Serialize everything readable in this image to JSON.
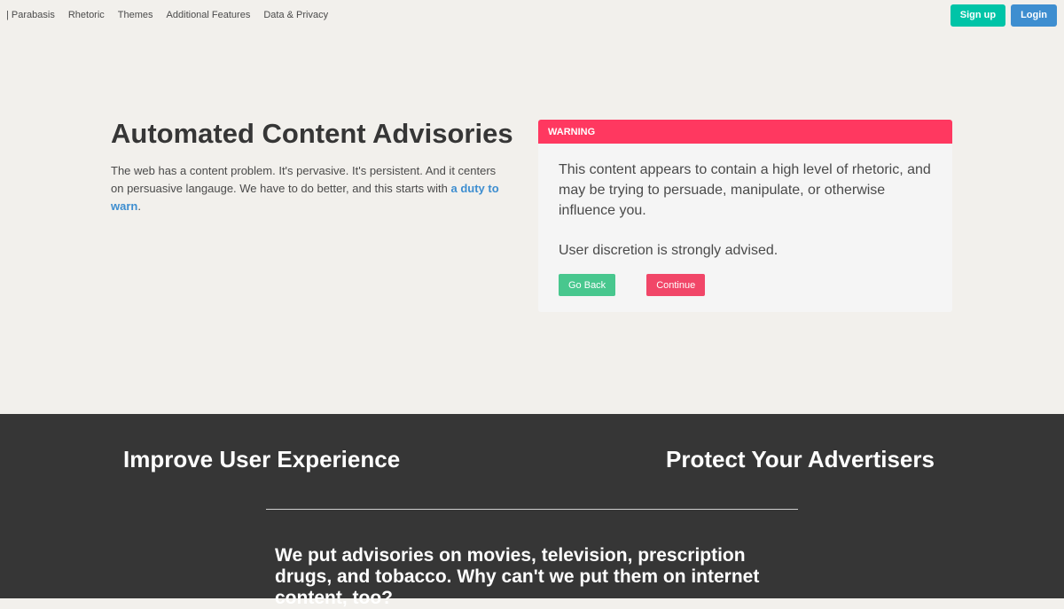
{
  "nav": {
    "items": [
      "| Parabasis",
      "Rhetoric",
      "Themes",
      "Additional Features",
      "Data & Privacy"
    ],
    "signup_label": "Sign up",
    "login_label": "Login"
  },
  "hero": {
    "title": "Automated Content Advisories",
    "text": "The web has a content problem. It's pervasive. It's persistent. And it centers on persuasive langauge. We have to do better, and this starts with ",
    "link_text": "a duty to warn",
    "text_end": "."
  },
  "warning": {
    "header": "WARNING",
    "message": "This content appears to contain a high level of rhetoric, and may be trying to persuade, manipulate, or otherwise influence you.",
    "disclaimer": "User discretion is strongly advised.",
    "go_back_label": "Go Back",
    "continue_label": "Continue"
  },
  "features": {
    "left_title": "Improve User Experience",
    "right_title": "Protect Your Advertisers",
    "tagline": "We put advisories on movies, television, prescription drugs, and tobacco. Why can't we put them on internet content, too?"
  },
  "colors": {
    "signup": "#00c4a7",
    "login": "#3e8ed0",
    "warning": "#ff3860",
    "go_back": "#48c78e",
    "continue": "#f14668",
    "dark_bg": "#363636"
  }
}
